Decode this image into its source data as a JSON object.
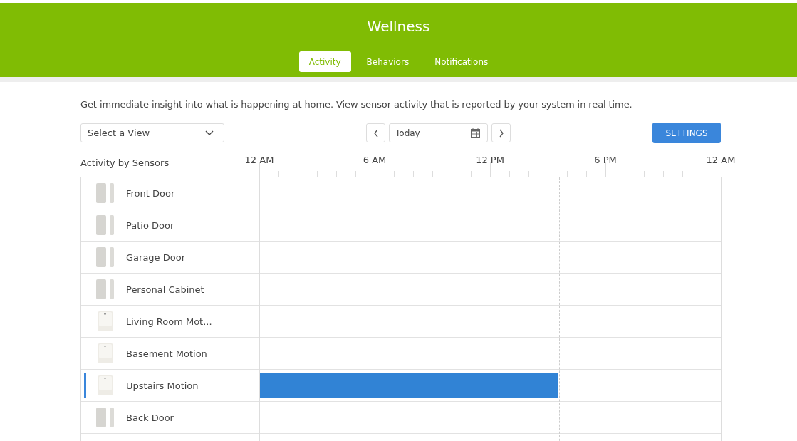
{
  "header": {
    "title": "Wellness"
  },
  "tabs": [
    {
      "label": "Activity",
      "selected": true
    },
    {
      "label": "Behaviors",
      "selected": false
    },
    {
      "label": "Notifications",
      "selected": false
    }
  ],
  "description": "Get immediate insight into what is happening at home. View sensor activity that is reported by your system in real time.",
  "view_select": {
    "value": "Select a View"
  },
  "date_field": {
    "value": "Today"
  },
  "settings_button": "SETTINGS",
  "timeline": {
    "heading": "Activity by Sensors",
    "hour_labels": [
      "12 AM",
      "6 AM",
      "12 PM",
      "6 PM",
      "12 AM"
    ],
    "now_marker": {
      "level": 0.648
    }
  },
  "sensors": [
    {
      "name": "Front Door",
      "kind": "door",
      "selected": false
    },
    {
      "name": "Patio Door",
      "kind": "door",
      "selected": false
    },
    {
      "name": "Garage Door",
      "kind": "door",
      "selected": false
    },
    {
      "name": "Personal Cabinet",
      "kind": "door",
      "selected": false
    },
    {
      "name": "Living Room Mot...",
      "kind": "motion",
      "selected": false
    },
    {
      "name": "Basement Motion",
      "kind": "motion",
      "selected": false
    },
    {
      "name": "Upstairs Motion",
      "kind": "motion",
      "selected": true,
      "activity": {
        "level": 0.648
      }
    },
    {
      "name": "Back Door",
      "kind": "door",
      "selected": false
    }
  ]
}
